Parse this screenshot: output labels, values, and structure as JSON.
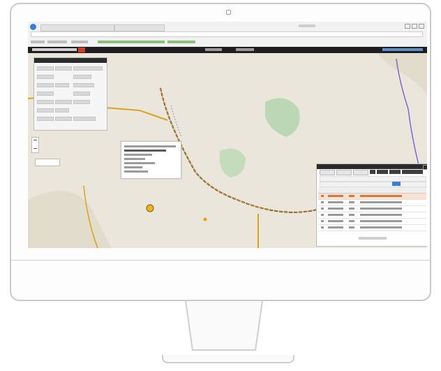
{
  "browser": {
    "tabs": [
      {
        "label": ""
      },
      {
        "label": ""
      }
    ],
    "bookmarks": [
      {
        "label": ""
      },
      {
        "label": ""
      },
      {
        "label": ""
      },
      {
        "label": ""
      },
      {
        "label": ""
      }
    ]
  },
  "app": {
    "title": "",
    "nav": [
      {
        "label": ""
      },
      {
        "label": ""
      },
      {
        "label": ""
      }
    ]
  },
  "vehicle_panel": {
    "heading": ""
  },
  "popup": {
    "lines": []
  },
  "history_panel": {
    "heading": "",
    "rows": []
  },
  "map_type": {
    "label": ""
  },
  "colors": {
    "header_bg": "#1e1e1e",
    "route_line": "#d9a21b",
    "track_line": "#2a2a2a",
    "forest": "#bcd7b4",
    "water": "#9ec6e8",
    "badge": "#d23a2f",
    "selected_button": "#3a7fd2"
  }
}
